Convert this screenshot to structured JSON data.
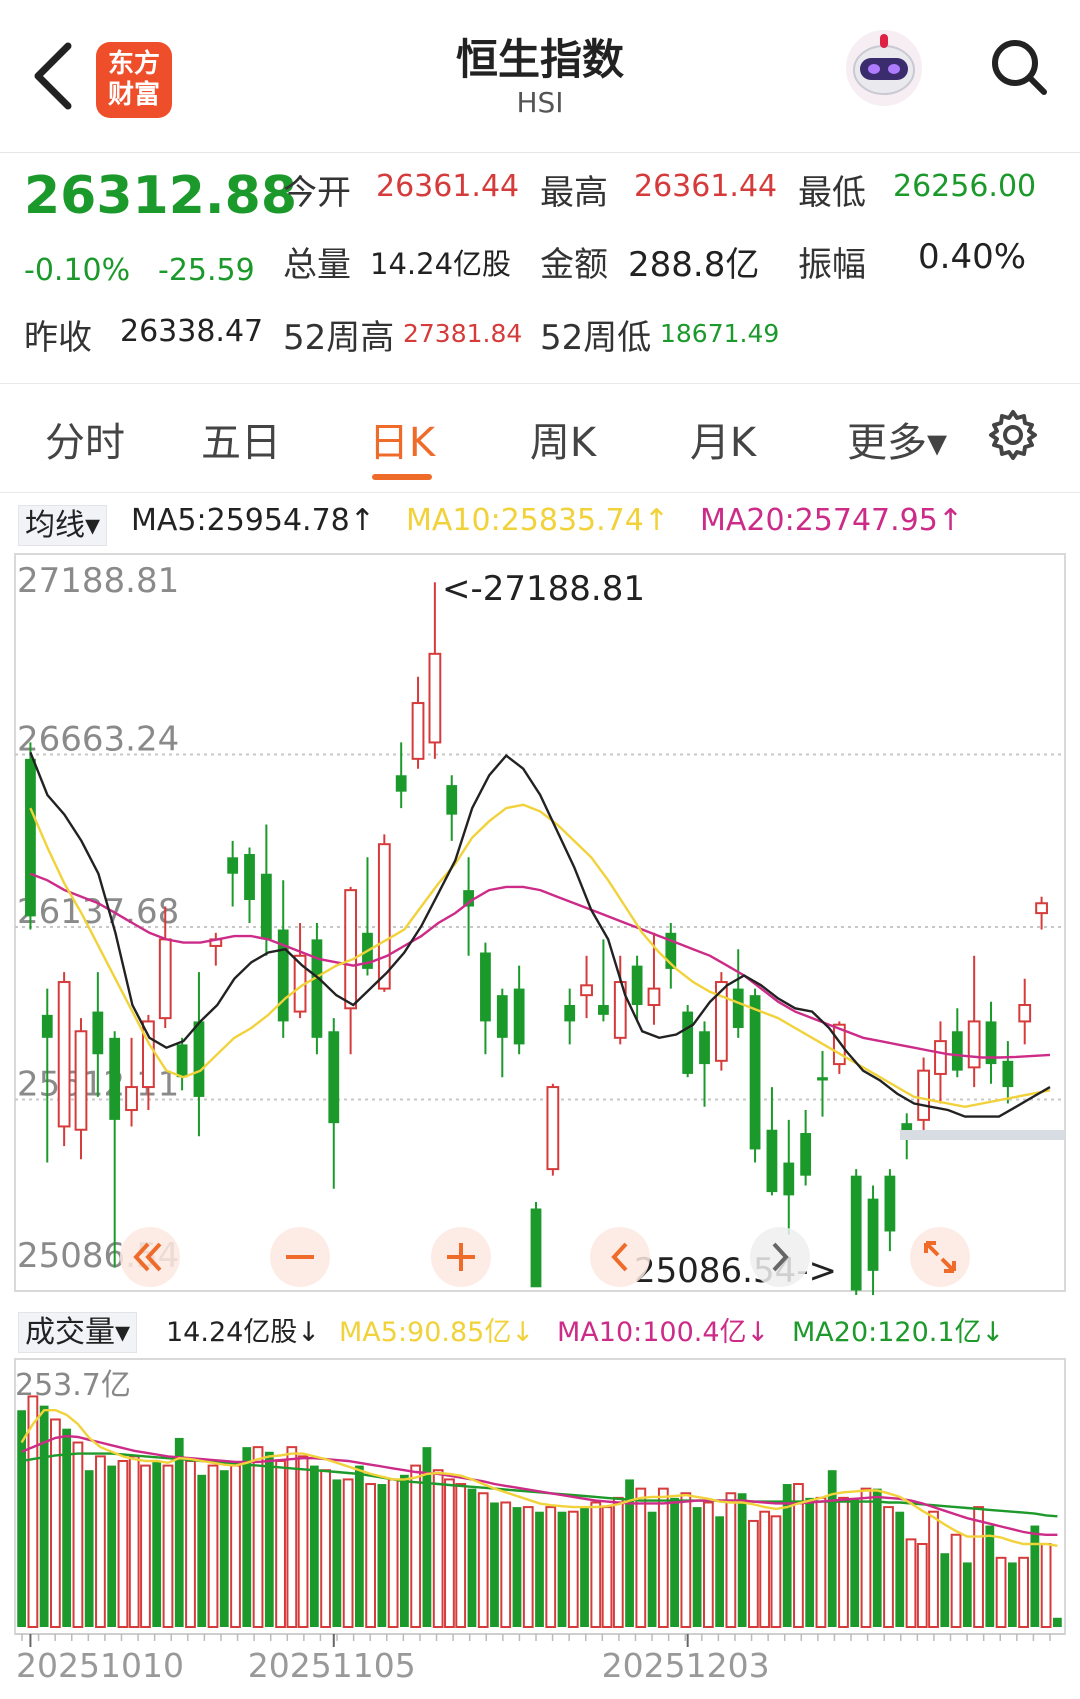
{
  "header": {
    "title": "恒生指数",
    "subtitle": "HSI",
    "logo_line1": "东方",
    "logo_line2": "财富"
  },
  "quote": {
    "price": "26312.88",
    "change_pct": "-0.10%",
    "change_val": "-25.59",
    "prev_close_label": "昨收",
    "prev_close": "26338.47",
    "open_label": "今开",
    "open": "26361.44",
    "high_label": "最高",
    "high": "26361.44",
    "low_label": "最低",
    "low": "26256.00",
    "volume_label": "总量",
    "volume": "14.24亿股",
    "amount_label": "金额",
    "amount": "288.8亿",
    "amplitude_label": "振幅",
    "amplitude": "0.40%",
    "w52_high_label": "52周高",
    "w52_high": "27381.84",
    "w52_low_label": "52周低",
    "w52_low": "18671.49"
  },
  "tabs": [
    {
      "label": "分时",
      "active": false
    },
    {
      "label": "五日",
      "active": false
    },
    {
      "label": "日K",
      "active": true
    },
    {
      "label": "周K",
      "active": false
    },
    {
      "label": "月K",
      "active": false
    },
    {
      "label": "更多▾",
      "active": false
    }
  ],
  "ma_legend": {
    "selector": "均线▾",
    "ma5": "MA5:25954.78↑",
    "ma10": "MA10:25835.74↑",
    "ma20": "MA20:25747.95↑"
  },
  "vol_legend": {
    "selector": "成交量▾",
    "current": "14.24亿股↓",
    "ma5": "MA5:90.85亿↓",
    "ma10": "MA10:100.4亿↓",
    "ma20": "MA20:120.1亿↓"
  },
  "colors": {
    "up": "#d63b3b",
    "down": "#1b9a2b",
    "ma5": "#222222",
    "ma10": "#f2d23a",
    "ma20": "#cc2b88",
    "accent": "#ef6b2a"
  },
  "chart_data": [
    {
      "type": "candlestick",
      "y_labels": [
        "27188.81",
        "26663.24",
        "26137.68",
        "25612.11",
        "25086.54"
      ],
      "ylim": [
        25086.54,
        27188.81
      ],
      "max_annotation": "<-27188.81",
      "min_annotation": "25086.54->",
      "x_labels": [
        "20251010",
        "20251105",
        "20251203"
      ],
      "x_label_indices": [
        0,
        18,
        39
      ],
      "candles": [
        [
          26650,
          26170,
          26700,
          26130
        ],
        [
          25870,
          25800,
          25950,
          25420
        ],
        [
          25530,
          25970,
          26000,
          25470
        ],
        [
          25520,
          25820,
          25860,
          25430
        ],
        [
          25880,
          25750,
          26000,
          25620
        ],
        [
          25800,
          25550,
          25820,
          25100
        ],
        [
          25580,
          25650,
          25800,
          25530
        ],
        [
          25650,
          25850,
          25870,
          25580
        ],
        [
          25860,
          26100,
          26200,
          25830
        ],
        [
          25780,
          25680,
          25800,
          25640
        ],
        [
          25850,
          25620,
          26000,
          25500
        ],
        [
          26080,
          26100,
          26120,
          26020
        ],
        [
          26350,
          26300,
          26400,
          26200
        ],
        [
          26360,
          26220,
          26380,
          26150
        ],
        [
          26300,
          26100,
          26450,
          26050
        ],
        [
          26130,
          25850,
          26280,
          25800
        ],
        [
          25880,
          26050,
          26150,
          25860
        ],
        [
          26100,
          25800,
          26150,
          25750
        ],
        [
          25820,
          25540,
          25860,
          25340
        ],
        [
          25890,
          26250,
          26260,
          25750
        ],
        [
          26120,
          26010,
          26350,
          25990
        ],
        [
          25950,
          26390,
          26420,
          25940
        ],
        [
          26600,
          26550,
          26700,
          26500
        ],
        [
          26650,
          26820,
          26900,
          26620
        ],
        [
          26700,
          26970,
          27188,
          26650
        ],
        [
          26570,
          26480,
          26600,
          26400
        ],
        [
          26250,
          26200,
          26350,
          26050
        ],
        [
          26060,
          25850,
          26090,
          25750
        ],
        [
          25930,
          25800,
          25950,
          25680
        ],
        [
          25950,
          25780,
          26020,
          25750
        ],
        [
          25280,
          25040,
          25300,
          25060
        ],
        [
          25400,
          25650,
          25660,
          25380
        ],
        [
          25900,
          25850,
          25950,
          25780
        ],
        [
          25930,
          25960,
          26050,
          25860
        ],
        [
          25900,
          25870,
          26100,
          25850
        ],
        [
          25800,
          25970,
          26050,
          25780
        ],
        [
          26020,
          25900,
          26050,
          25850
        ],
        [
          25900,
          25950,
          26120,
          25840
        ],
        [
          26120,
          26010,
          26150,
          25950
        ],
        [
          25880,
          25690,
          25900,
          25680
        ],
        [
          25820,
          25720,
          25850,
          25590
        ],
        [
          25730,
          25970,
          26000,
          25700
        ],
        [
          25950,
          25830,
          26070,
          25800
        ],
        [
          25930,
          25460,
          25950,
          25420
        ],
        [
          25520,
          25330,
          25650,
          25320
        ],
        [
          25420,
          25320,
          25550,
          25200
        ],
        [
          25510,
          25380,
          25580,
          25350
        ],
        [
          25680,
          25670,
          25760,
          25560
        ],
        [
          25720,
          25840,
          25850,
          25690
        ],
        [
          25380,
          25030,
          25400,
          25000
        ],
        [
          25310,
          25090,
          25350,
          25000
        ],
        [
          25380,
          25210,
          25400,
          25150
        ],
        [
          25540,
          25490,
          25570,
          25430
        ],
        [
          25550,
          25700,
          25740,
          25500
        ],
        [
          25690,
          25790,
          25850,
          25600
        ],
        [
          25820,
          25700,
          25890,
          25680
        ],
        [
          25710,
          25850,
          26050,
          25650
        ],
        [
          25850,
          25720,
          25910,
          25660
        ],
        [
          25730,
          25650,
          25790,
          25600
        ],
        [
          25850,
          25900,
          25980,
          25780
        ],
        [
          26180,
          26210,
          26230,
          26130
        ]
      ],
      "ma5": [
        26670,
        26540,
        26480,
        26400,
        26300,
        26120,
        25900,
        25800,
        25770,
        25790,
        25850,
        25900,
        25980,
        26030,
        26060,
        26070,
        26020,
        25980,
        25930,
        25900,
        25950,
        26000,
        26060,
        26140,
        26240,
        26340,
        26500,
        26600,
        26660,
        26620,
        26540,
        26430,
        26320,
        26190,
        26100,
        25930,
        25820,
        25800,
        25810,
        25840,
        25910,
        25960,
        25990,
        25960,
        25920,
        25890,
        25880,
        25830,
        25760,
        25700,
        25670,
        25630,
        25600,
        25590,
        25580,
        25560,
        25560,
        25560,
        25590,
        25620,
        25650
      ],
      "ma10": [
        26500,
        26380,
        26270,
        26180,
        26080,
        25980,
        25880,
        25780,
        25700,
        25680,
        25700,
        25750,
        25800,
        25830,
        25870,
        25920,
        25960,
        25990,
        26020,
        26040,
        26070,
        26100,
        26130,
        26200,
        26270,
        26330,
        26410,
        26460,
        26500,
        26510,
        26490,
        26450,
        26400,
        26350,
        26280,
        26200,
        26120,
        26060,
        26010,
        25970,
        25940,
        25920,
        25900,
        25880,
        25860,
        25830,
        25800,
        25770,
        25740,
        25710,
        25680,
        25650,
        25620,
        25610,
        25600,
        25590,
        25600,
        25610,
        25620,
        25630,
        25640
      ],
      "ma20": [
        26300,
        26280,
        26250,
        26230,
        26210,
        26180,
        26150,
        26120,
        26100,
        26090,
        26090,
        26100,
        26110,
        26110,
        26100,
        26080,
        26060,
        26040,
        26030,
        26020,
        26030,
        26050,
        26080,
        26110,
        26150,
        26180,
        26220,
        26250,
        26260,
        26260,
        26250,
        26230,
        26210,
        26190,
        26170,
        26150,
        26130,
        26110,
        26090,
        26070,
        26050,
        26020,
        25990,
        25950,
        25910,
        25880,
        25860,
        25840,
        25820,
        25800,
        25790,
        25780,
        25770,
        25760,
        25750,
        25745,
        25740,
        25740,
        25742,
        25745,
        25748
      ]
    },
    {
      "type": "bar",
      "title": "成交量",
      "y_labels": [
        "253.7亿"
      ],
      "ylim": [
        0,
        253.7
      ],
      "vol": [
        235,
        250,
        240,
        225,
        215,
        200,
        170,
        185,
        175,
        180,
        185,
        175,
        180,
        175,
        205,
        180,
        165,
        175,
        170,
        175,
        195,
        195,
        190,
        180,
        195,
        185,
        175,
        170,
        160,
        160,
        175,
        155,
        155,
        160,
        165,
        175,
        195,
        170,
        160,
        155,
        150,
        145,
        135,
        135,
        130,
        130,
        125,
        130,
        125,
        125,
        130,
        135,
        130,
        140,
        160,
        150,
        125,
        150,
        140,
        145,
        130,
        135,
        120,
        145,
        145,
        115,
        125,
        120,
        155,
        155,
        140,
        140,
        170,
        140,
        140,
        150,
        150,
        130,
        125,
        95,
        90,
        125,
        80,
        100,
        70,
        130,
        110,
        75,
        70,
        75,
        110,
        90,
        10
      ],
      "vol_ma5": [
        200,
        220,
        235,
        235,
        230,
        220,
        205,
        195,
        190,
        185,
        182,
        180,
        180,
        178,
        183,
        182,
        180,
        178,
        176,
        175,
        178,
        182,
        185,
        186,
        188,
        188,
        185,
        182,
        178,
        174,
        170,
        166,
        163,
        160,
        160,
        162,
        166,
        167,
        166,
        164,
        160,
        155,
        150,
        146,
        142,
        138,
        134,
        132,
        131,
        130,
        130,
        130,
        131,
        133,
        137,
        140,
        141,
        141,
        142,
        143,
        141,
        139,
        136,
        135,
        135,
        133,
        130,
        128,
        130,
        134,
        137,
        140,
        144,
        146,
        147,
        148,
        148,
        145,
        141,
        134,
        126,
        119,
        111,
        104,
        98,
        98,
        99,
        97,
        93,
        90,
        90,
        90,
        88
      ],
      "vol_ma10": [
        190,
        195,
        200,
        205,
        207,
        206,
        203,
        200,
        197,
        194,
        191,
        189,
        187,
        185,
        184,
        183,
        182,
        181,
        180,
        179,
        179,
        179,
        180,
        181,
        182,
        183,
        183,
        182,
        181,
        180,
        178,
        176,
        174,
        172,
        170,
        168,
        167,
        166,
        164,
        162,
        160,
        158,
        155,
        153,
        151,
        149,
        147,
        145,
        143,
        141,
        139,
        137,
        136,
        135,
        134,
        134,
        134,
        134,
        135,
        136,
        137,
        137,
        137,
        137,
        137,
        136,
        135,
        134,
        134,
        134,
        135,
        136,
        137,
        138,
        139,
        140,
        141,
        140,
        139,
        137,
        134,
        130,
        126,
        122,
        118,
        115,
        112,
        109,
        106,
        103,
        101,
        100,
        100
      ],
      "vol_ma20": [
        180,
        182,
        184,
        186,
        187,
        188,
        188,
        188,
        188,
        187,
        186,
        185,
        184,
        183,
        182,
        181,
        180,
        179,
        178,
        177,
        176,
        175,
        174,
        173,
        172,
        171,
        170,
        169,
        168,
        167,
        166,
        164,
        162,
        160,
        158,
        157,
        156,
        155,
        154,
        153,
        152,
        151,
        150,
        149,
        148,
        147,
        146,
        145,
        144,
        143,
        142,
        141,
        140,
        139,
        138,
        137,
        137,
        137,
        137,
        137,
        137,
        137,
        137,
        137,
        137,
        136,
        136,
        136,
        136,
        136,
        136,
        136,
        136,
        136,
        136,
        136,
        136,
        135,
        135,
        134,
        133,
        132,
        131,
        130,
        129,
        128,
        127,
        126,
        125,
        124,
        123,
        121,
        120
      ]
    }
  ]
}
